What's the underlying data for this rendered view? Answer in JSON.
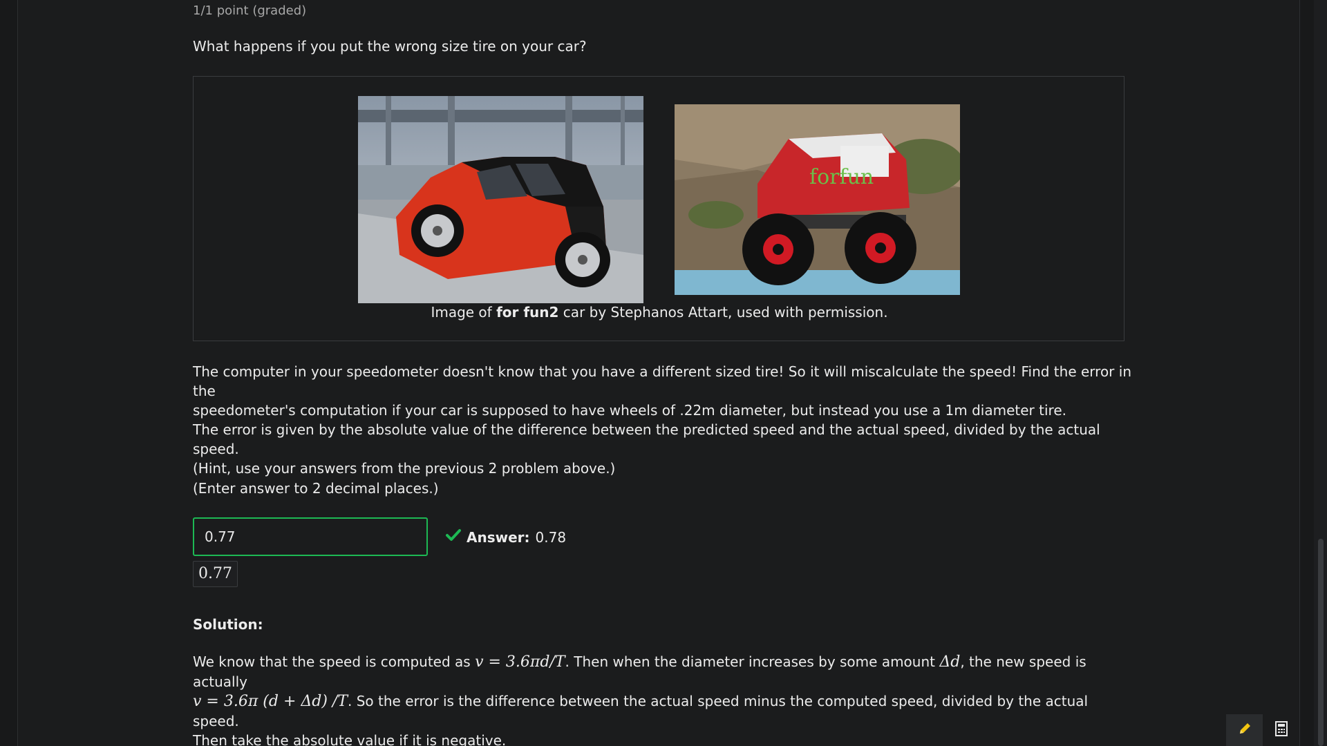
{
  "problem": {
    "points": "1/1 point (graded)",
    "question": "What happens if you put the wrong size tire on your car?"
  },
  "figure": {
    "caption_prefix": "Image of ",
    "caption_bold": "for fun2",
    "caption_suffix": " car by Stephanos Attart, used with permission.",
    "image2_text": "forfun"
  },
  "paragraphs": {
    "p1_line1": "The computer in your speedometer doesn't know that you have a different sized tire! So it will miscalculate the speed! Find the error in the",
    "p1_line2": "speedometer's computation if your car is supposed to have wheels of .22m diameter, but instead you use a 1m diameter tire.",
    "p2_line1": "The error is given by the absolute value of the difference between the predicted speed and the actual speed, divided by the actual speed.",
    "p2_line2": "(Hint, use your answers from the previous 2 problem above.)",
    "p3": "(Enter answer to 2 decimal places.)"
  },
  "answer": {
    "input_value": "0.77",
    "preview": "0.77",
    "status_label": "Answer:",
    "correct_value": "0.78",
    "status_color": "#1db954"
  },
  "solution": {
    "title": "Solution:",
    "l1_a": "We know that the speed is computed as ",
    "l1_math1": "v = 3.6πd/T",
    "l1_b": ". Then when the diameter increases by some amount ",
    "l1_math2": "Δd",
    "l1_c": ", the new speed is actually",
    "l2_math": "v = 3.6π (d + Δd) /T",
    "l2_b": ". So the error is the difference between the actual speed minus the computed speed, divided by the actual speed.",
    "l3": "Then take the absolute value if it is negative."
  },
  "toolbar": {
    "pencil_icon": "pencil-icon",
    "calculator_icon": "calculator-icon",
    "accent": "#f2c511"
  }
}
